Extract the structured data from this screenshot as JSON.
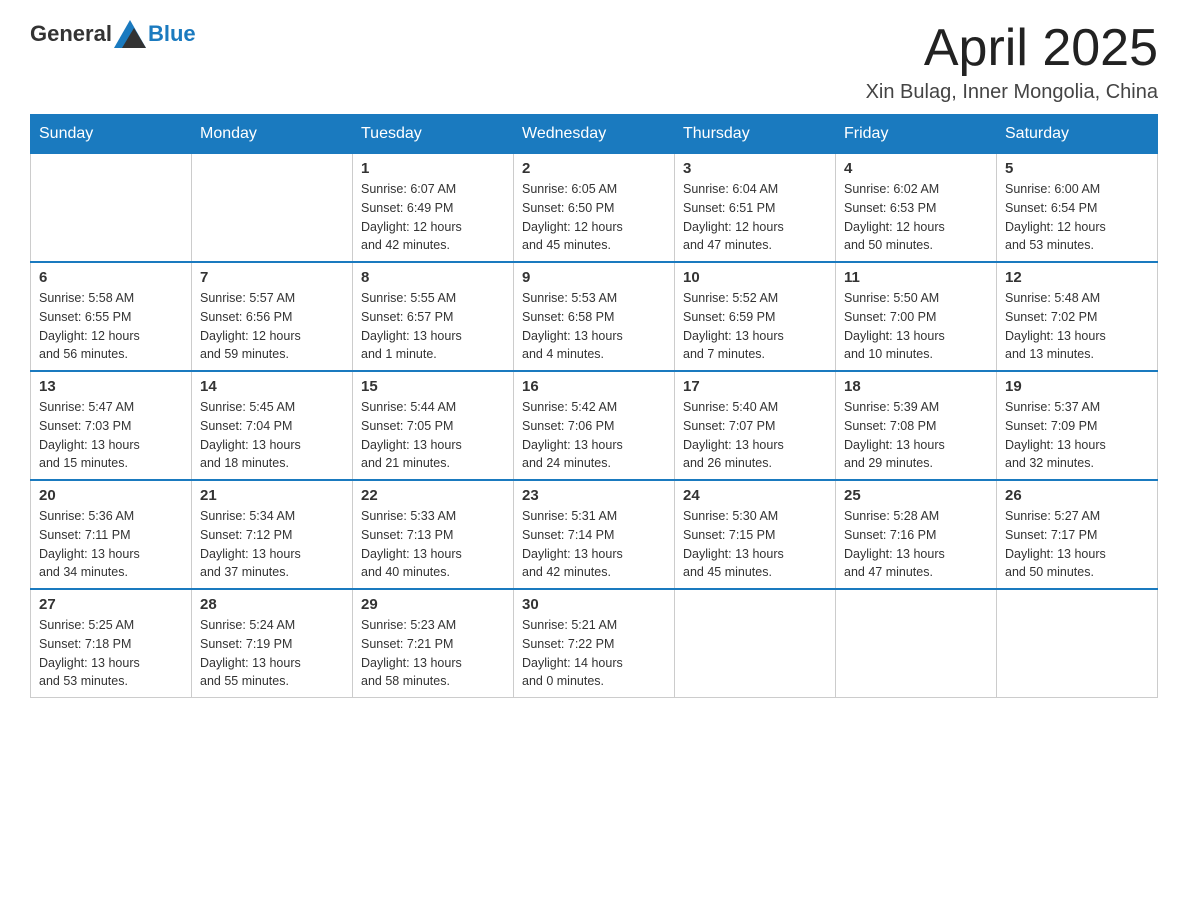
{
  "header": {
    "logo_general": "General",
    "logo_blue": "Blue",
    "month_title": "April 2025",
    "location": "Xin Bulag, Inner Mongolia, China"
  },
  "weekdays": [
    "Sunday",
    "Monday",
    "Tuesday",
    "Wednesday",
    "Thursday",
    "Friday",
    "Saturday"
  ],
  "weeks": [
    [
      {
        "day": "",
        "info": ""
      },
      {
        "day": "",
        "info": ""
      },
      {
        "day": "1",
        "info": "Sunrise: 6:07 AM\nSunset: 6:49 PM\nDaylight: 12 hours\nand 42 minutes."
      },
      {
        "day": "2",
        "info": "Sunrise: 6:05 AM\nSunset: 6:50 PM\nDaylight: 12 hours\nand 45 minutes."
      },
      {
        "day": "3",
        "info": "Sunrise: 6:04 AM\nSunset: 6:51 PM\nDaylight: 12 hours\nand 47 minutes."
      },
      {
        "day": "4",
        "info": "Sunrise: 6:02 AM\nSunset: 6:53 PM\nDaylight: 12 hours\nand 50 minutes."
      },
      {
        "day": "5",
        "info": "Sunrise: 6:00 AM\nSunset: 6:54 PM\nDaylight: 12 hours\nand 53 minutes."
      }
    ],
    [
      {
        "day": "6",
        "info": "Sunrise: 5:58 AM\nSunset: 6:55 PM\nDaylight: 12 hours\nand 56 minutes."
      },
      {
        "day": "7",
        "info": "Sunrise: 5:57 AM\nSunset: 6:56 PM\nDaylight: 12 hours\nand 59 minutes."
      },
      {
        "day": "8",
        "info": "Sunrise: 5:55 AM\nSunset: 6:57 PM\nDaylight: 13 hours\nand 1 minute."
      },
      {
        "day": "9",
        "info": "Sunrise: 5:53 AM\nSunset: 6:58 PM\nDaylight: 13 hours\nand 4 minutes."
      },
      {
        "day": "10",
        "info": "Sunrise: 5:52 AM\nSunset: 6:59 PM\nDaylight: 13 hours\nand 7 minutes."
      },
      {
        "day": "11",
        "info": "Sunrise: 5:50 AM\nSunset: 7:00 PM\nDaylight: 13 hours\nand 10 minutes."
      },
      {
        "day": "12",
        "info": "Sunrise: 5:48 AM\nSunset: 7:02 PM\nDaylight: 13 hours\nand 13 minutes."
      }
    ],
    [
      {
        "day": "13",
        "info": "Sunrise: 5:47 AM\nSunset: 7:03 PM\nDaylight: 13 hours\nand 15 minutes."
      },
      {
        "day": "14",
        "info": "Sunrise: 5:45 AM\nSunset: 7:04 PM\nDaylight: 13 hours\nand 18 minutes."
      },
      {
        "day": "15",
        "info": "Sunrise: 5:44 AM\nSunset: 7:05 PM\nDaylight: 13 hours\nand 21 minutes."
      },
      {
        "day": "16",
        "info": "Sunrise: 5:42 AM\nSunset: 7:06 PM\nDaylight: 13 hours\nand 24 minutes."
      },
      {
        "day": "17",
        "info": "Sunrise: 5:40 AM\nSunset: 7:07 PM\nDaylight: 13 hours\nand 26 minutes."
      },
      {
        "day": "18",
        "info": "Sunrise: 5:39 AM\nSunset: 7:08 PM\nDaylight: 13 hours\nand 29 minutes."
      },
      {
        "day": "19",
        "info": "Sunrise: 5:37 AM\nSunset: 7:09 PM\nDaylight: 13 hours\nand 32 minutes."
      }
    ],
    [
      {
        "day": "20",
        "info": "Sunrise: 5:36 AM\nSunset: 7:11 PM\nDaylight: 13 hours\nand 34 minutes."
      },
      {
        "day": "21",
        "info": "Sunrise: 5:34 AM\nSunset: 7:12 PM\nDaylight: 13 hours\nand 37 minutes."
      },
      {
        "day": "22",
        "info": "Sunrise: 5:33 AM\nSunset: 7:13 PM\nDaylight: 13 hours\nand 40 minutes."
      },
      {
        "day": "23",
        "info": "Sunrise: 5:31 AM\nSunset: 7:14 PM\nDaylight: 13 hours\nand 42 minutes."
      },
      {
        "day": "24",
        "info": "Sunrise: 5:30 AM\nSunset: 7:15 PM\nDaylight: 13 hours\nand 45 minutes."
      },
      {
        "day": "25",
        "info": "Sunrise: 5:28 AM\nSunset: 7:16 PM\nDaylight: 13 hours\nand 47 minutes."
      },
      {
        "day": "26",
        "info": "Sunrise: 5:27 AM\nSunset: 7:17 PM\nDaylight: 13 hours\nand 50 minutes."
      }
    ],
    [
      {
        "day": "27",
        "info": "Sunrise: 5:25 AM\nSunset: 7:18 PM\nDaylight: 13 hours\nand 53 minutes."
      },
      {
        "day": "28",
        "info": "Sunrise: 5:24 AM\nSunset: 7:19 PM\nDaylight: 13 hours\nand 55 minutes."
      },
      {
        "day": "29",
        "info": "Sunrise: 5:23 AM\nSunset: 7:21 PM\nDaylight: 13 hours\nand 58 minutes."
      },
      {
        "day": "30",
        "info": "Sunrise: 5:21 AM\nSunset: 7:22 PM\nDaylight: 14 hours\nand 0 minutes."
      },
      {
        "day": "",
        "info": ""
      },
      {
        "day": "",
        "info": ""
      },
      {
        "day": "",
        "info": ""
      }
    ]
  ]
}
